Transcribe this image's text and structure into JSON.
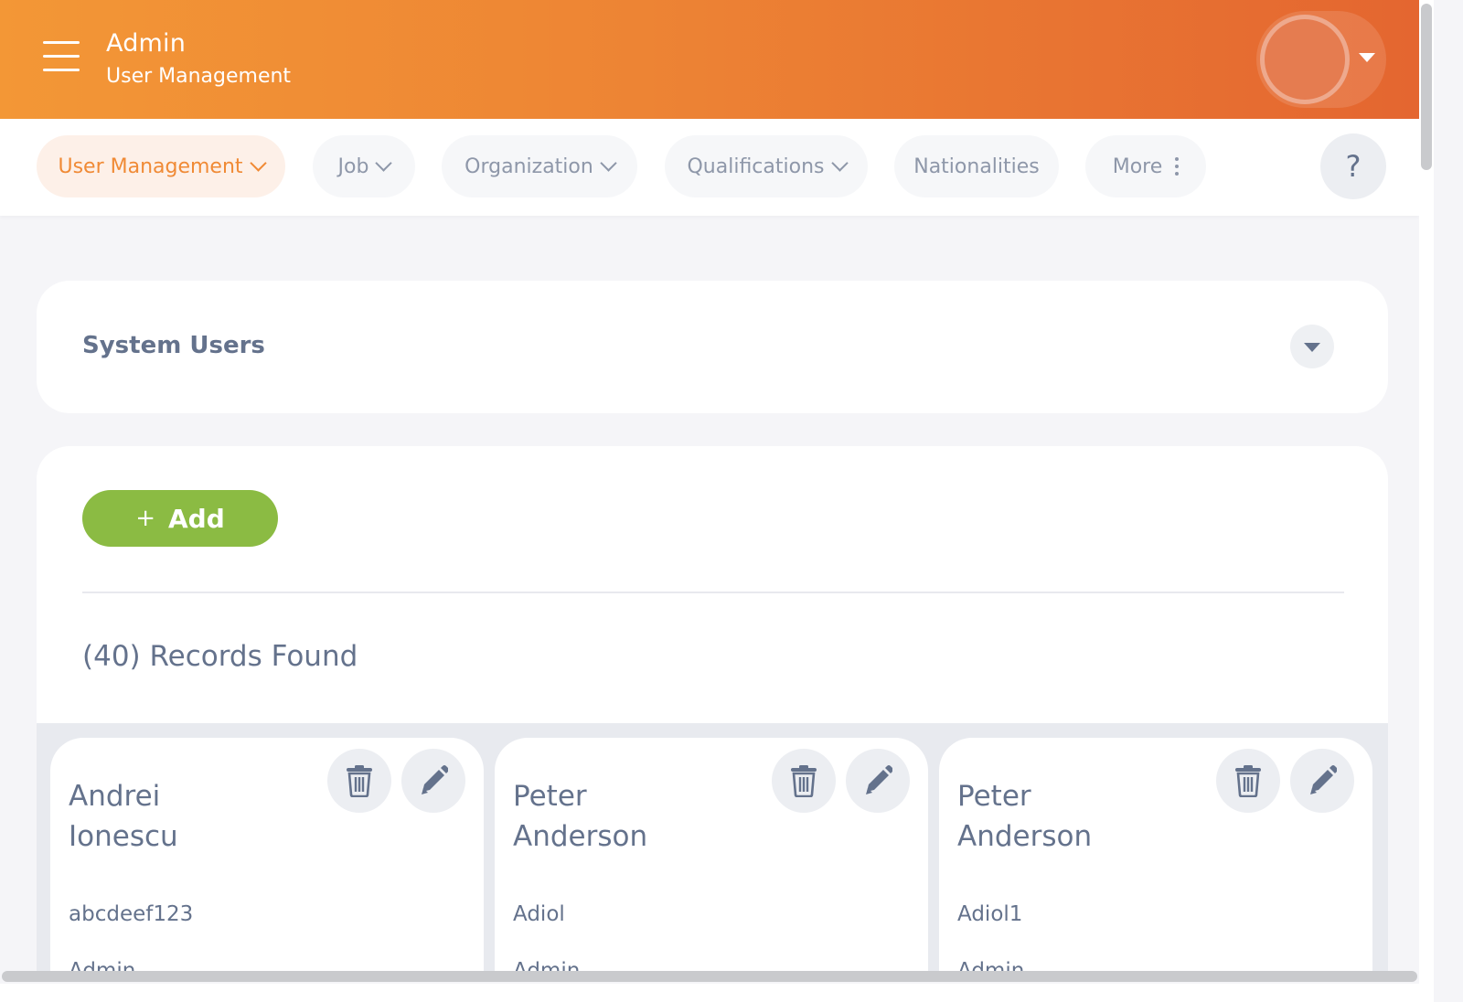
{
  "header": {
    "title": "Admin",
    "subtitle": "User Management",
    "menu_icon": "hamburger-icon",
    "user_caret_icon": "caret-down-icon"
  },
  "nav": {
    "items": [
      {
        "label": "User Management",
        "active": true,
        "icon": "chevron-down-icon"
      },
      {
        "label": "Job",
        "active": false,
        "icon": "chevron-down-icon"
      },
      {
        "label": "Organization",
        "active": false,
        "icon": "chevron-down-icon"
      },
      {
        "label": "Qualifications",
        "active": false,
        "icon": "chevron-down-icon"
      },
      {
        "label": "Nationalities",
        "active": false
      },
      {
        "label": "More",
        "active": false,
        "icon": "kebab-icon"
      }
    ],
    "help_label": "?"
  },
  "filter": {
    "title": "System Users",
    "toggle_icon": "caret-down-icon"
  },
  "list": {
    "add_plus": "+",
    "add_label": "Add",
    "records_label": "(40) Records Found",
    "users": [
      {
        "first_name": "Andrei",
        "last_name": "Ionescu",
        "username": "abcdeef123",
        "role": "Admin"
      },
      {
        "first_name": "Peter",
        "last_name": "Anderson",
        "username": "Adiol",
        "role": "Admin"
      },
      {
        "first_name": "Peter",
        "last_name": "Anderson",
        "username": "Adiol1",
        "role": "Admin"
      }
    ]
  },
  "colors": {
    "header_gradient_start": "#f39736",
    "header_gradient_end": "#e46630",
    "accent": "#f08a35",
    "add_button": "#8bbb43",
    "text": "#64728c"
  }
}
